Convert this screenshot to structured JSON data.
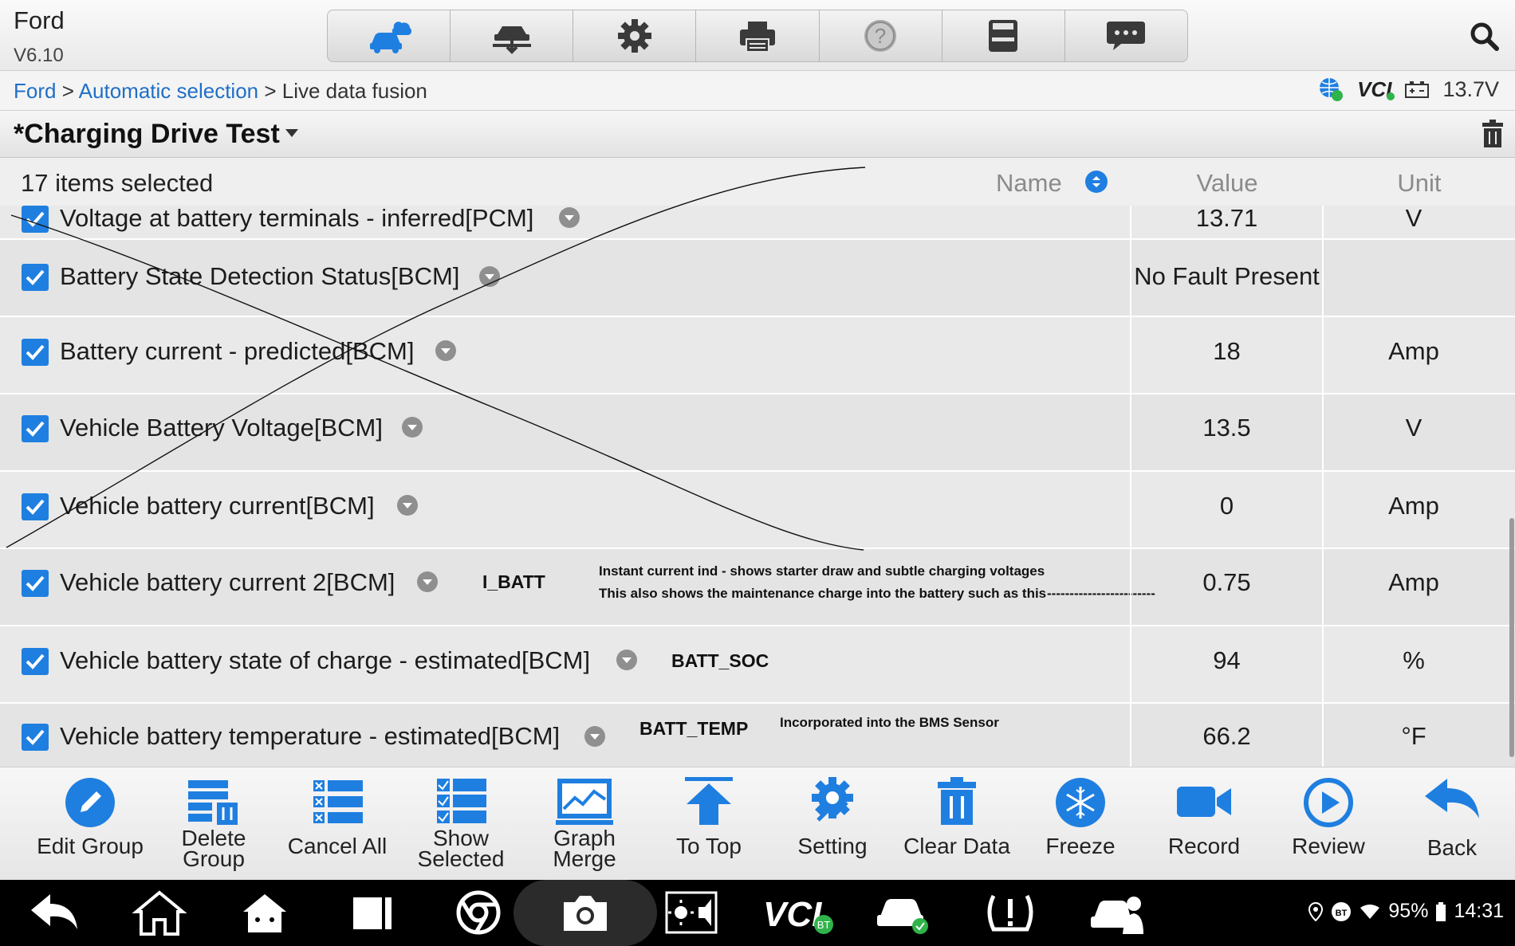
{
  "app": {
    "brand": "Ford",
    "version": "V6.10"
  },
  "toolbar": {
    "buttons": [
      "vehicle-cloud",
      "lift-vehicle",
      "settings",
      "print",
      "help",
      "save",
      "messages"
    ]
  },
  "breadcrumb": {
    "link1": "Ford",
    "sep1": " > ",
    "link2": "Automatic selection",
    "sep2": " > ",
    "current": "Live data fusion"
  },
  "status": {
    "vci": "VCI",
    "voltage": "13.7V"
  },
  "title": "*Charging Drive Test",
  "table": {
    "selected_count": "17 items selected",
    "headers": {
      "name": "Name",
      "value": "Value",
      "unit": "Unit"
    },
    "rows": [
      {
        "name": "Voltage at battery terminals - inferred[PCM]",
        "value": "13.71",
        "unit": "V"
      },
      {
        "name": "Battery State Detection Status[BCM]",
        "value": "No Fault Present",
        "unit": ""
      },
      {
        "name": "Battery current - predicted[BCM]",
        "value": "18",
        "unit": "Amp"
      },
      {
        "name": "Vehicle Battery Voltage[BCM]",
        "value": "13.5",
        "unit": "V"
      },
      {
        "name": "Vehicle battery current[BCM]",
        "value": "0",
        "unit": "Amp"
      },
      {
        "name": "Vehicle battery current 2[BCM]",
        "value": "0.75",
        "unit": "Amp"
      },
      {
        "name": "Vehicle battery state of charge - estimated[BCM]",
        "value": "94",
        "unit": "%"
      },
      {
        "name": "Vehicle battery temperature - estimated[BCM]",
        "value": "66.2",
        "unit": "°F"
      }
    ]
  },
  "annotations": {
    "ibatt_code": "I_BATT",
    "ibatt_line1": "Instant current ind - shows starter draw and subtle charging voltages",
    "ibatt_line2": "This also shows the maintenance charge into the battery such as this",
    "ibatt_dashes": "------------------------",
    "soc_code": "BATT_SOC",
    "temp_code": "BATT_TEMP",
    "temp_note": "Incorporated into the BMS Sensor"
  },
  "actions": {
    "edit_group": "Edit Group",
    "delete_group_1": "Delete",
    "delete_group_2": "Group",
    "cancel_all": "Cancel All",
    "show_selected_1": "Show",
    "show_selected_2": "Selected",
    "graph_merge_1": "Graph",
    "graph_merge_2": "Merge",
    "to_top": "To Top",
    "setting": "Setting",
    "clear_data": "Clear Data",
    "freeze": "Freeze",
    "record": "Record",
    "review": "Review",
    "back": "Back"
  },
  "system": {
    "vci": "VCI",
    "bt_badge": "BT",
    "battery": "95%",
    "time": "14:31"
  },
  "colors": {
    "accent": "#1f7fe0",
    "link": "#1f6fc6"
  }
}
